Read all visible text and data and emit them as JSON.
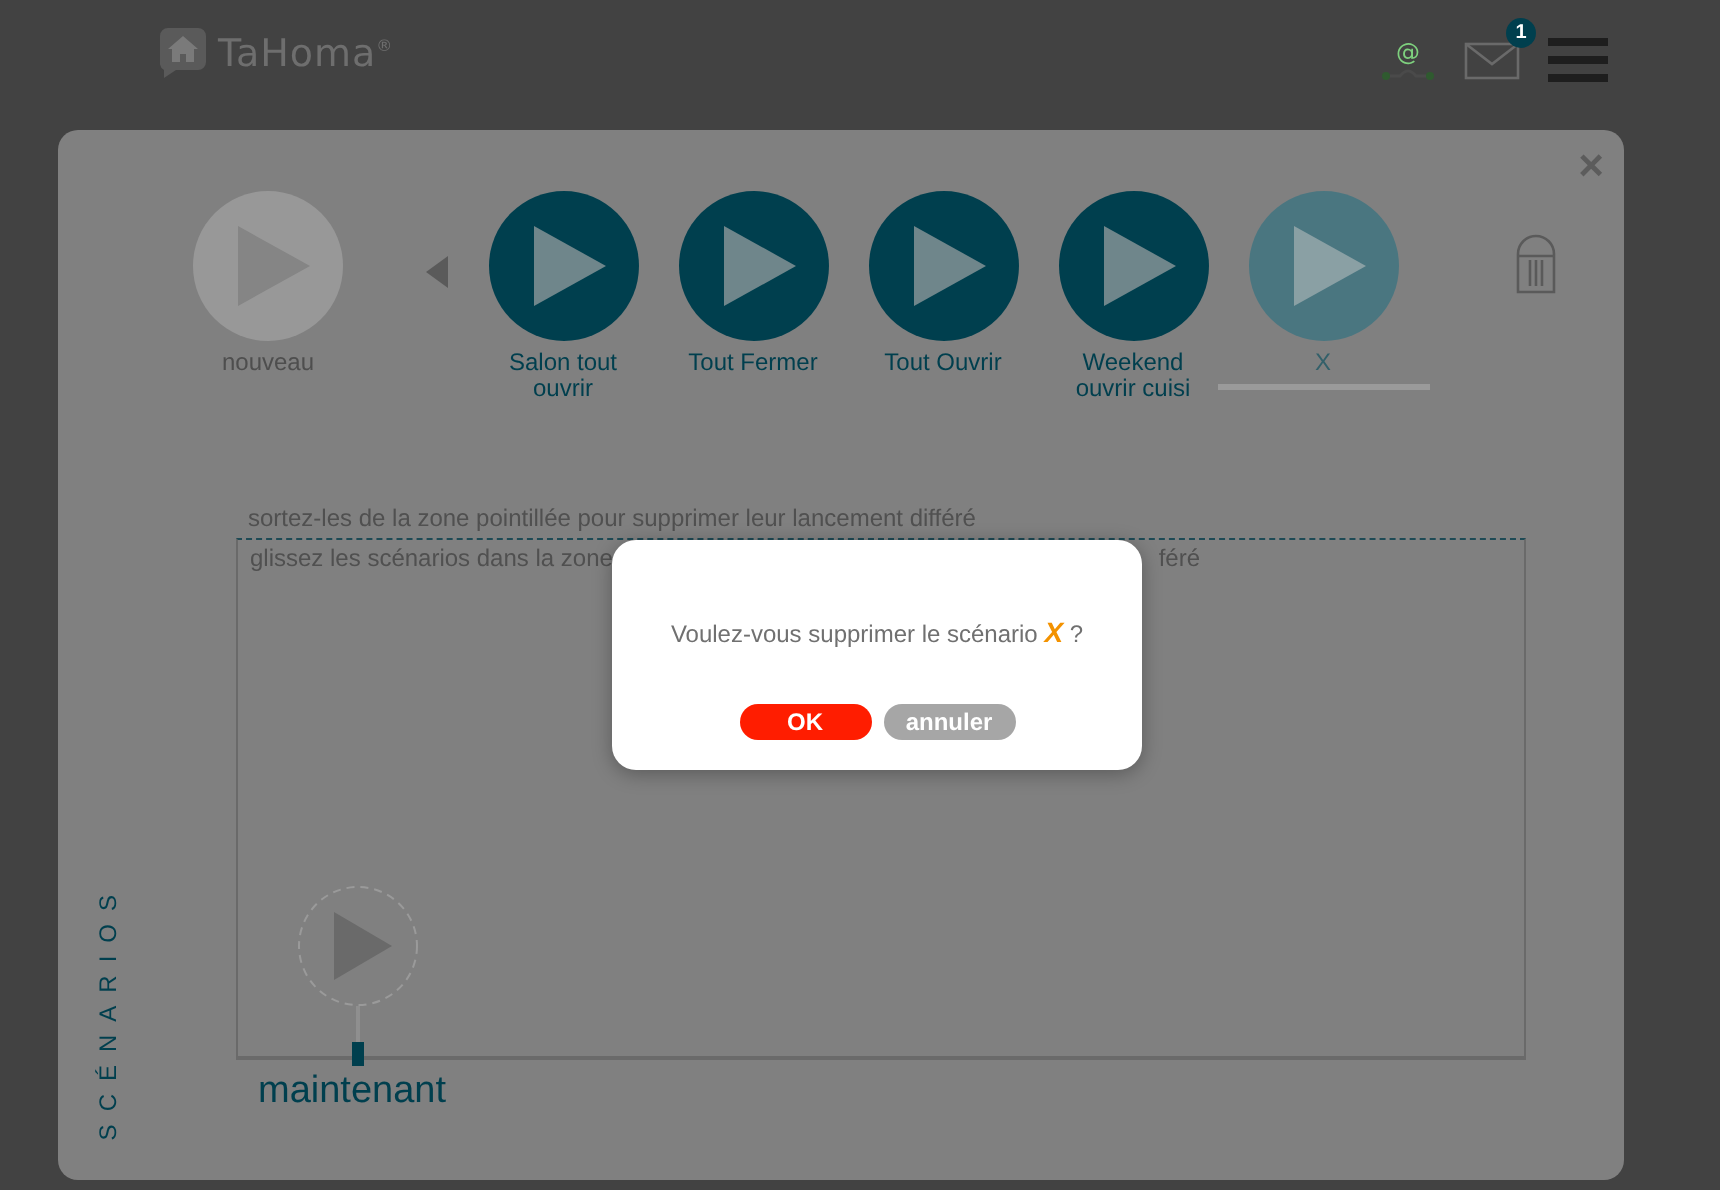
{
  "header": {
    "logo": "TaHoma$^{®}$",
    "network_icon": "@",
    "mail_badge": "1"
  },
  "close": "×",
  "scenarios": [
    {
      "kind": "new",
      "label": "nouveau",
      "selected": false
    },
    {
      "kind": "scenario",
      "label": "Salon tout ouvrir",
      "selected": false
    },
    {
      "kind": "scenario",
      "label": "Tout Fermer",
      "selected": false
    },
    {
      "kind": "scenario",
      "label": "Tout Ouvrir",
      "selected": false
    },
    {
      "kind": "scenario",
      "label": "Weekend ouvrir cuisi",
      "selected": false
    },
    {
      "kind": "scenario",
      "label": "X",
      "selected": true
    }
  ],
  "zone": {
    "hint_remove": "sortez-les de la zone pointillée pour supprimer leur lancement différé",
    "hint_add_start": "glissez les scénarios dans la zone",
    "hint_add_end": "féré",
    "now_label": "maintenant"
  },
  "side_title": "SCÉNARIOS",
  "dialog": {
    "message": "Voulez-vous supprimer le scénario *X* ?",
    "buttons": [
      {
        "kind": "confirm",
        "label": "OK"
      },
      {
        "kind": "cancel",
        "label": "annuler"
      }
    ]
  }
}
